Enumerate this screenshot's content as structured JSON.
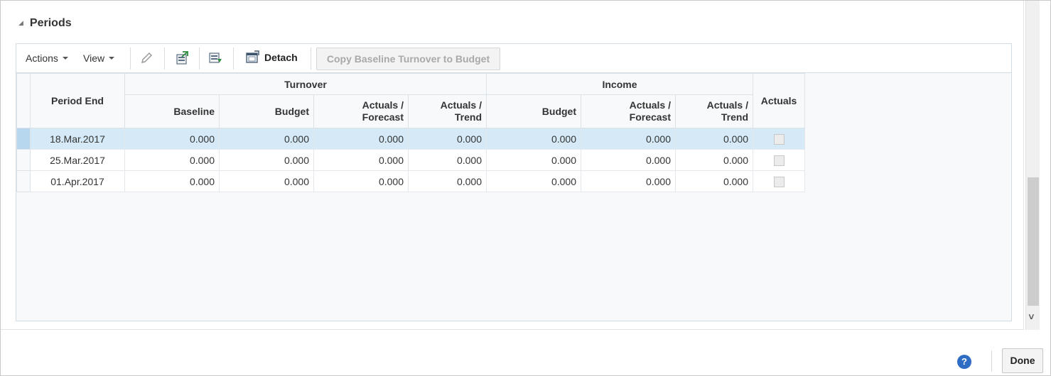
{
  "section": {
    "title": "Periods"
  },
  "toolbar": {
    "actions_label": "Actions",
    "view_label": "View",
    "icons": [
      "pencil-icon",
      "export-icon",
      "import-icon",
      "detach-icon"
    ],
    "detach_label": "Detach",
    "copy_label": "Copy Baseline Turnover to Budget"
  },
  "table": {
    "headers": {
      "period_end": "Period End",
      "turnover": "Turnover",
      "income": "Income",
      "actuals": "Actuals",
      "baseline": "Baseline",
      "budget": "Budget",
      "actuals_forecast_1": "Actuals /",
      "actuals_forecast_2": "Forecast",
      "actuals_trend_1": "Actuals /",
      "actuals_trend_2": "Trend"
    },
    "rows": [
      {
        "period_end": "18.Mar.2017",
        "t_baseline": "0.000",
        "t_budget": "0.000",
        "t_forecast": "0.000",
        "t_trend": "0.000",
        "i_budget": "0.000",
        "i_forecast": "0.000",
        "i_trend": "0.000",
        "actuals": false,
        "selected": true
      },
      {
        "period_end": "25.Mar.2017",
        "t_baseline": "0.000",
        "t_budget": "0.000",
        "t_forecast": "0.000",
        "t_trend": "0.000",
        "i_budget": "0.000",
        "i_forecast": "0.000",
        "i_trend": "0.000",
        "actuals": false,
        "selected": false
      },
      {
        "period_end": "01.Apr.2017",
        "t_baseline": "0.000",
        "t_budget": "0.000",
        "t_forecast": "0.000",
        "t_trend": "0.000",
        "i_budget": "0.000",
        "i_forecast": "0.000",
        "i_trend": "0.000",
        "actuals": false,
        "selected": false
      }
    ]
  },
  "footer": {
    "help_label": "?",
    "done_label": "Done"
  },
  "colors": {
    "selected_row": "#d5e9f7",
    "help_icon": "#2f6dc4"
  }
}
